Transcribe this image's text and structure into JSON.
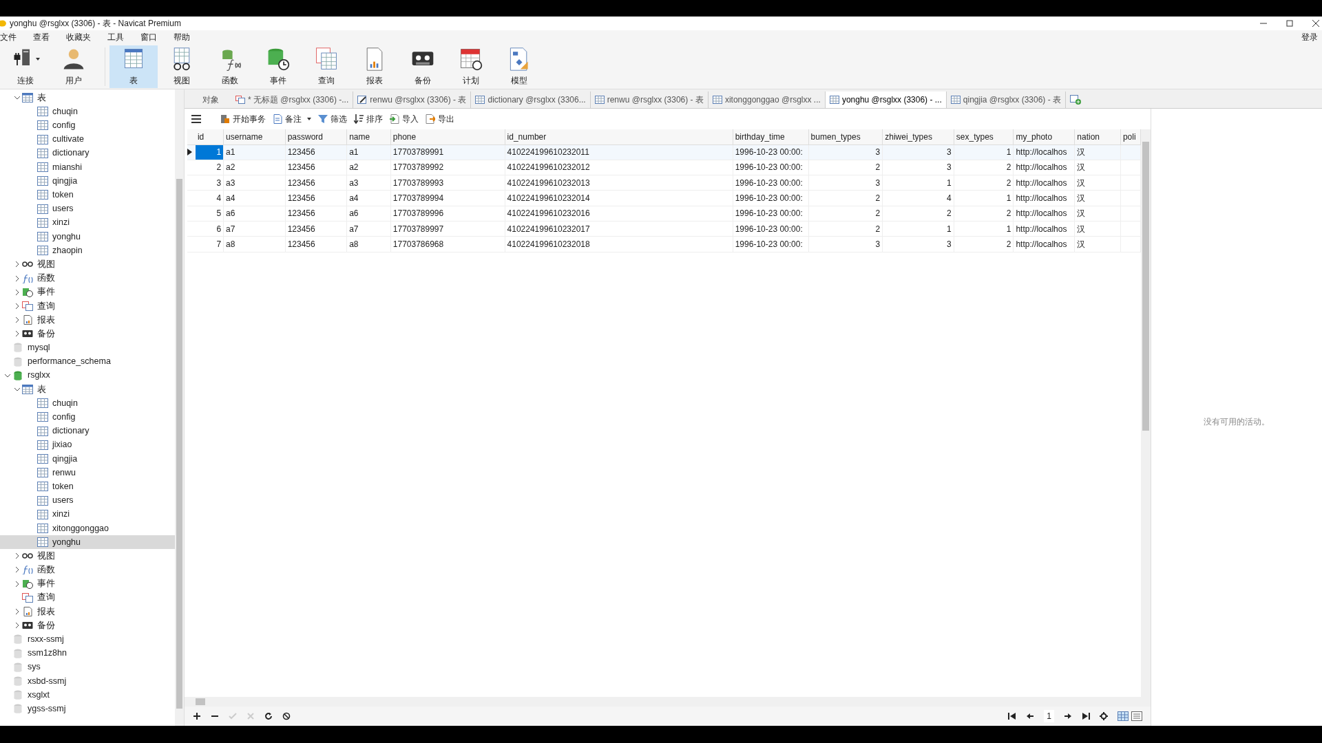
{
  "window": {
    "title": "yonghu @rsglxx (3306) - 表 - Navicat Premium"
  },
  "menu": [
    "文件",
    "查看",
    "收藏夹",
    "工具",
    "窗口",
    "帮助"
  ],
  "login": "登录",
  "toolbar": [
    {
      "label": "连接",
      "kind": "connect",
      "selected": false
    },
    {
      "label": "用户",
      "kind": "user",
      "selected": false
    },
    {
      "label": "表",
      "kind": "table",
      "selected": true
    },
    {
      "label": "视图",
      "kind": "view",
      "selected": false
    },
    {
      "label": "函数",
      "kind": "function",
      "selected": false
    },
    {
      "label": "事件",
      "kind": "event",
      "selected": false
    },
    {
      "label": "查询",
      "kind": "query",
      "selected": false
    },
    {
      "label": "报表",
      "kind": "report",
      "selected": false
    },
    {
      "label": "备份",
      "kind": "backup",
      "selected": false
    },
    {
      "label": "计划",
      "kind": "schedule",
      "selected": false
    },
    {
      "label": "模型",
      "kind": "model",
      "selected": false
    }
  ],
  "tree": [
    {
      "children": [
        {
          "label": "表",
          "kind": "tables",
          "expanded": true,
          "children": [
            {
              "label": "chuqin",
              "kind": "table",
              "selected": false
            },
            {
              "label": "config",
              "kind": "table",
              "selected": false
            },
            {
              "label": "cultivate",
              "kind": "table",
              "selected": false
            },
            {
              "label": "dictionary",
              "kind": "table",
              "selected": false
            },
            {
              "label": "mianshi",
              "kind": "table",
              "selected": false
            },
            {
              "label": "qingjia",
              "kind": "table",
              "selected": false
            },
            {
              "label": "token",
              "kind": "table",
              "selected": false
            },
            {
              "label": "users",
              "kind": "table",
              "selected": false
            },
            {
              "label": "xinzi",
              "kind": "table",
              "selected": false
            },
            {
              "label": "yonghu",
              "kind": "table",
              "selected": false
            },
            {
              "label": "zhaopin",
              "kind": "table",
              "selected": false
            }
          ]
        },
        {
          "label": "视图",
          "kind": "views",
          "expanded": false
        },
        {
          "label": "函数",
          "kind": "functions",
          "expanded": false
        },
        {
          "label": "事件",
          "kind": "events",
          "expanded": false
        },
        {
          "label": "查询",
          "kind": "queries",
          "expanded": false
        },
        {
          "label": "报表",
          "kind": "reports",
          "expanded": false
        },
        {
          "label": "备份",
          "kind": "backups",
          "expanded": false
        }
      ]
    },
    {
      "label": "mysql",
      "kind": "database"
    },
    {
      "label": "performance_schema",
      "kind": "database"
    },
    {
      "label": "rsglxx",
      "kind": "database",
      "expanded": true,
      "children": [
        {
          "label": "表",
          "kind": "tables",
          "expanded": true,
          "children": [
            {
              "label": "chuqin",
              "kind": "table",
              "selected": false
            },
            {
              "label": "config",
              "kind": "table",
              "selected": false
            },
            {
              "label": "dictionary",
              "kind": "table",
              "selected": false
            },
            {
              "label": "jixiao",
              "kind": "table",
              "selected": false
            },
            {
              "label": "qingjia",
              "kind": "table",
              "selected": false
            },
            {
              "label": "renwu",
              "kind": "table",
              "selected": false
            },
            {
              "label": "token",
              "kind": "table",
              "selected": false
            },
            {
              "label": "users",
              "kind": "table",
              "selected": false
            },
            {
              "label": "xinzi",
              "kind": "table",
              "selected": false
            },
            {
              "label": "xitonggonggao",
              "kind": "table",
              "selected": false
            },
            {
              "label": "yonghu",
              "kind": "table",
              "selected": true
            }
          ]
        },
        {
          "label": "视图",
          "kind": "views",
          "expanded": false
        },
        {
          "label": "函数",
          "kind": "functions",
          "expanded": false
        },
        {
          "label": "事件",
          "kind": "events",
          "expanded": false
        },
        {
          "label": "查询",
          "kind": "queries"
        },
        {
          "label": "报表",
          "kind": "reports",
          "expanded": false
        },
        {
          "label": "备份",
          "kind": "backups",
          "expanded": false
        }
      ]
    },
    {
      "label": "rsxx-ssmj",
      "kind": "database"
    },
    {
      "label": "ssm1z8hn",
      "kind": "database"
    },
    {
      "label": "sys",
      "kind": "database"
    },
    {
      "label": "xsbd-ssmj",
      "kind": "database"
    },
    {
      "label": "xsglxt",
      "kind": "database"
    },
    {
      "label": "ygss-ssmj",
      "kind": "database"
    }
  ],
  "tabs": [
    {
      "label": "对象",
      "kind": "objects",
      "selected": false
    },
    {
      "label": "* 无标题 @rsglxx (3306) -...",
      "kind": "query",
      "selected": false
    },
    {
      "label": "renwu @rsglxx (3306) - 表",
      "kind": "design",
      "selected": false
    },
    {
      "label": "dictionary @rsglxx (3306...",
      "kind": "table",
      "selected": false
    },
    {
      "label": "renwu @rsglxx (3306) - 表",
      "kind": "table",
      "selected": false
    },
    {
      "label": "xitonggonggao @rsglxx ...",
      "kind": "table",
      "selected": false
    },
    {
      "label": "yonghu @rsglxx (3306) - ...",
      "kind": "table",
      "selected": true
    },
    {
      "label": "qingjia @rsglxx (3306) - 表",
      "kind": "table",
      "selected": false
    }
  ],
  "actions": [
    {
      "label": "开始事务",
      "kind": "transaction"
    },
    {
      "label": "备注",
      "kind": "memo"
    },
    {
      "label": "筛选",
      "kind": "filter"
    },
    {
      "label": "排序",
      "kind": "sort"
    },
    {
      "label": "导入",
      "kind": "import"
    },
    {
      "label": "导出",
      "kind": "export"
    }
  ],
  "table": {
    "columns": [
      {
        "label": "id"
      },
      {
        "label": "username"
      },
      {
        "label": "password"
      },
      {
        "label": "name"
      },
      {
        "label": "phone"
      },
      {
        "label": "id_number"
      },
      {
        "label": "birthday_time"
      },
      {
        "label": "bumen_types"
      },
      {
        "label": "zhiwei_types"
      },
      {
        "label": "sex_types"
      },
      {
        "label": "my_photo"
      },
      {
        "label": "nation"
      },
      {
        "label": "poli"
      }
    ],
    "rows": [
      {
        "selected": true,
        "cells": [
          "1",
          "a1",
          "123456",
          "a1",
          "17703789991",
          "410224199610232011",
          "1996-10-23 00:00:",
          "3",
          "3",
          "1",
          "http://localhos",
          "汉",
          ""
        ]
      },
      {
        "selected": false,
        "cells": [
          "2",
          "a2",
          "123456",
          "a2",
          "17703789992",
          "410224199610232012",
          "1996-10-23 00:00:",
          "2",
          "3",
          "2",
          "http://localhos",
          "汉",
          ""
        ]
      },
      {
        "selected": false,
        "cells": [
          "3",
          "a3",
          "123456",
          "a3",
          "17703789993",
          "410224199610232013",
          "1996-10-23 00:00:",
          "3",
          "1",
          "2",
          "http://localhos",
          "汉",
          ""
        ]
      },
      {
        "selected": false,
        "cells": [
          "4",
          "a4",
          "123456",
          "a4",
          "17703789994",
          "410224199610232014",
          "1996-10-23 00:00:",
          "2",
          "4",
          "1",
          "http://localhos",
          "汉",
          ""
        ]
      },
      {
        "selected": false,
        "cells": [
          "5",
          "a6",
          "123456",
          "a6",
          "17703789996",
          "410224199610232016",
          "1996-10-23 00:00:",
          "2",
          "2",
          "2",
          "http://localhos",
          "汉",
          ""
        ]
      },
      {
        "selected": false,
        "cells": [
          "6",
          "a7",
          "123456",
          "a7",
          "17703789997",
          "410224199610232017",
          "1996-10-23 00:00:",
          "2",
          "1",
          "1",
          "http://localhos",
          "汉",
          ""
        ]
      },
      {
        "selected": false,
        "cells": [
          "7",
          "a8",
          "123456",
          "a8",
          "17703786968",
          "410224199610232018",
          "1996-10-23 00:00:",
          "3",
          "3",
          "2",
          "http://localhos",
          "汉",
          ""
        ]
      }
    ]
  },
  "pager": {
    "page": "1"
  },
  "activity": "没有可用的活动。"
}
